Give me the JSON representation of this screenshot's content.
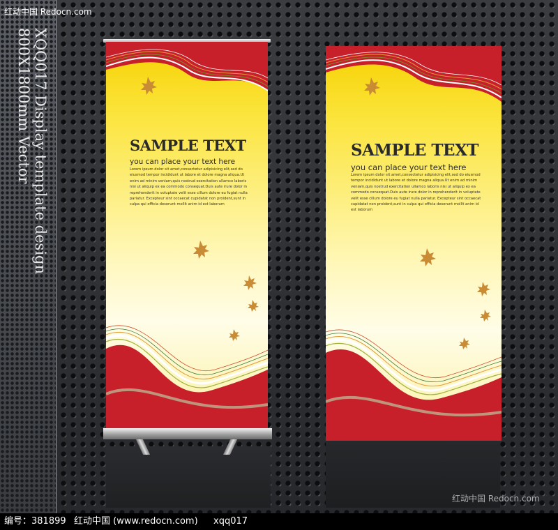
{
  "watermark": {
    "top_left": "红动中国 Redocn.com",
    "bottom_right": "红动中国 Redocn.com"
  },
  "side_caption": {
    "line1": "XQQ017 Display template design",
    "line2": "800X1800mm Vector"
  },
  "banners": [
    {
      "title": "SAMPLE TEXT",
      "subtitle": "you can place your text here",
      "body": "Lorem ipsum dolor sit amet,consectetur adipisicing elit,sed do eiusmod tempor incididunt ut labore et dolore magna aliqua.Ut enim ad minim veniam,quis nostrud exercitation ullamco laboris nisi ut aliquip ex ea commodo consequat.Duis aute irure dolor in reprehenderit in voluptate velit esse cillum dolore eu fugiat nulla pariatur. Excepteur sint occaecat cupidatat non proident,sunt in culpa qui officia deserunt mollit anim id est laborum"
    },
    {
      "title": "SAMPLE TEXT",
      "subtitle": "you can place your text here",
      "body": "Lorem ipsum dolor sit amet,consectetur adipisicing elit,sed do eiusmod tempor incididunt ut labore et dolore magna aliqua.Ut enim ad minim veniam,quis nostrud exercitation ullamco laboris nisi ut aliquip ex ea commodo consequat.Duis aute irure dolor in reprehenderit in voluptate velit esse cillum dolore eu fugiat nulla pariatur. Excepteur sint occaecat cupidatat non proident,sunt in culpa qui officia deserunt mollit anim id est laborum"
    }
  ],
  "footer": {
    "id_label": "编号：381899",
    "site": "红动中国 (www.redocn.com)",
    "author": "xqq017"
  },
  "colors": {
    "banner_red": "#c8202a",
    "banner_yellow": "#f6d000",
    "leaf": "#c98b34"
  }
}
